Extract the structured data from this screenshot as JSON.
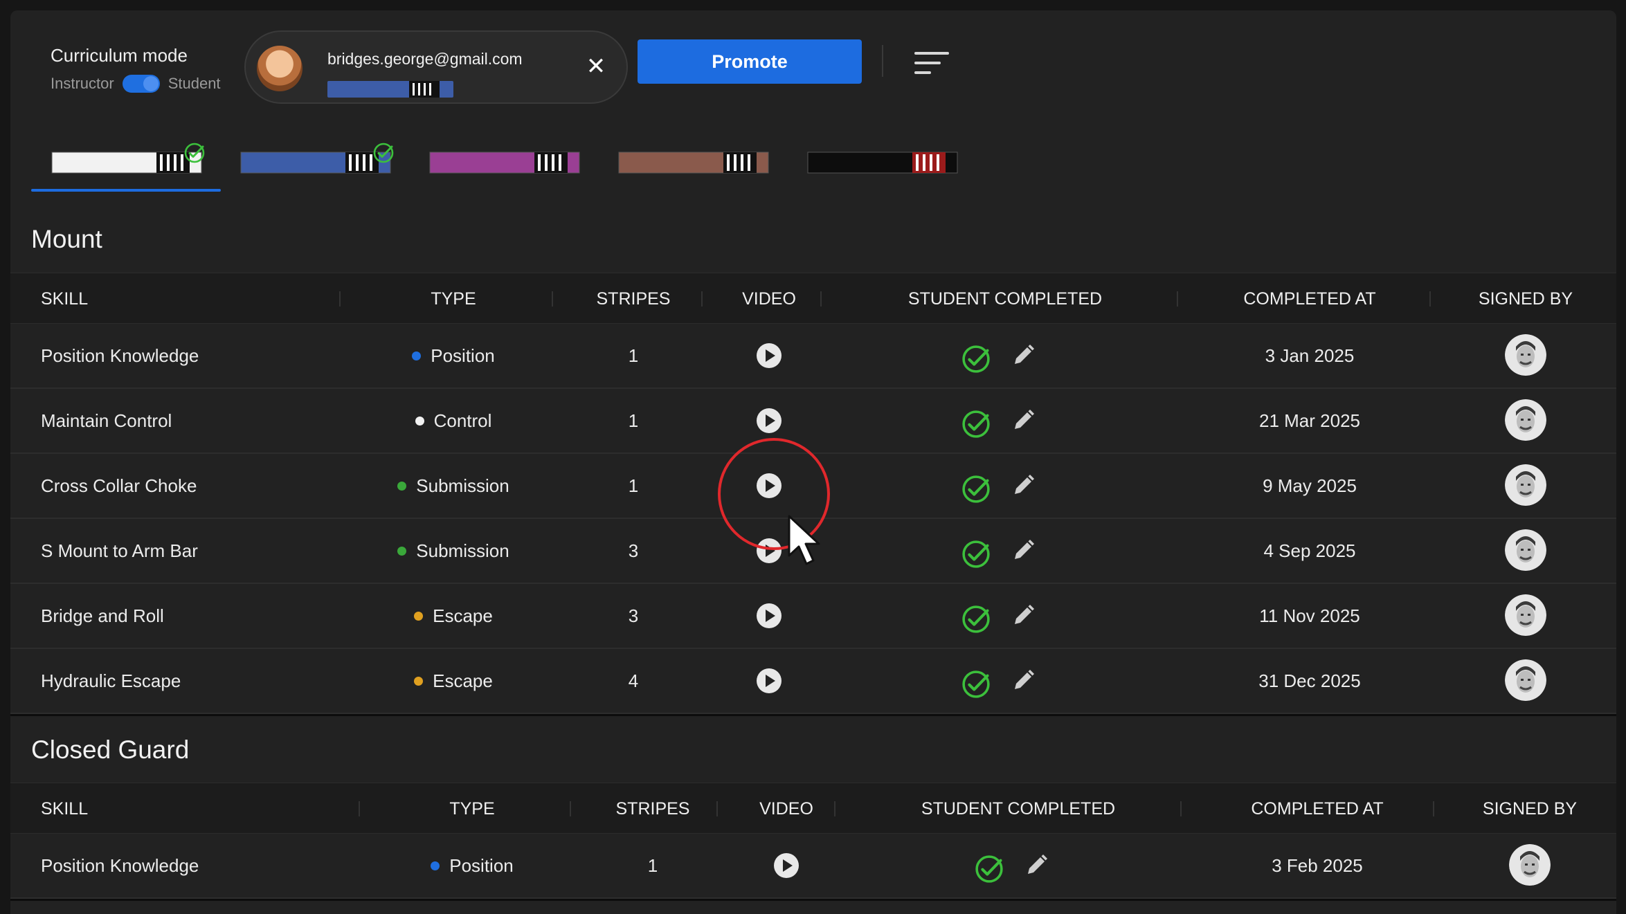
{
  "header": {
    "mode_title": "Curriculum mode",
    "mode_left": "Instructor",
    "mode_right": "Student",
    "student_email": "bridges.george@gmail.com",
    "promote_label": "Promote"
  },
  "belts": [
    {
      "name": "white",
      "color": "#f2f2f2",
      "stripe_bg": "#111111",
      "stripe_color": "#ffffff",
      "completed": true,
      "active": true
    },
    {
      "name": "blue",
      "color": "#3d5da8",
      "stripe_bg": "#111111",
      "stripe_color": "#ffffff",
      "completed": true,
      "active": false
    },
    {
      "name": "purple",
      "color": "#9a3f94",
      "stripe_bg": "#111111",
      "stripe_color": "#ffffff",
      "completed": false,
      "active": false
    },
    {
      "name": "brown",
      "color": "#8a5a4c",
      "stripe_bg": "#111111",
      "stripe_color": "#ffffff",
      "completed": false,
      "active": false
    },
    {
      "name": "black",
      "color": "#0d0d0d",
      "stripe_bg": "#9b1b1b",
      "stripe_color": "#ffffff",
      "completed": false,
      "active": false
    }
  ],
  "colors": {
    "position": "#1f6fe0",
    "control": "#f2f2f2",
    "submission": "#3aa83a",
    "escape": "#e0a020",
    "check": "#3cc03c"
  },
  "sections": [
    {
      "title": "Mount",
      "headers": [
        "SKILL",
        "TYPE",
        "STRIPES",
        "VIDEO",
        "STUDENT COMPLETED",
        "COMPLETED AT",
        "SIGNED BY"
      ],
      "rows": [
        {
          "skill": "Position Knowledge",
          "type": "Position",
          "type_color": "#1f6fe0",
          "stripes": "1",
          "completed_at": "3 Jan 2025"
        },
        {
          "skill": "Maintain Control",
          "type": "Control",
          "type_color": "#f2f2f2",
          "stripes": "1",
          "completed_at": "21 Mar 2025"
        },
        {
          "skill": "Cross Collar Choke",
          "type": "Submission",
          "type_color": "#3aa83a",
          "stripes": "1",
          "completed_at": "9 May 2025"
        },
        {
          "skill": "S Mount to Arm Bar",
          "type": "Submission",
          "type_color": "#3aa83a",
          "stripes": "3",
          "completed_at": "4 Sep 2025"
        },
        {
          "skill": "Bridge and Roll",
          "type": "Escape",
          "type_color": "#e0a020",
          "stripes": "3",
          "completed_at": "11 Nov 2025"
        },
        {
          "skill": "Hydraulic Escape",
          "type": "Escape",
          "type_color": "#e0a020",
          "stripes": "4",
          "completed_at": "31 Dec 2025"
        }
      ]
    },
    {
      "title": "Closed Guard",
      "headers": [
        "SKILL",
        "TYPE",
        "STRIPES",
        "VIDEO",
        "STUDENT COMPLETED",
        "COMPLETED AT",
        "SIGNED BY"
      ],
      "rows": [
        {
          "skill": "Position Knowledge",
          "type": "Position",
          "type_color": "#1f6fe0",
          "stripes": "1",
          "completed_at": "3 Feb 2025"
        }
      ]
    }
  ]
}
